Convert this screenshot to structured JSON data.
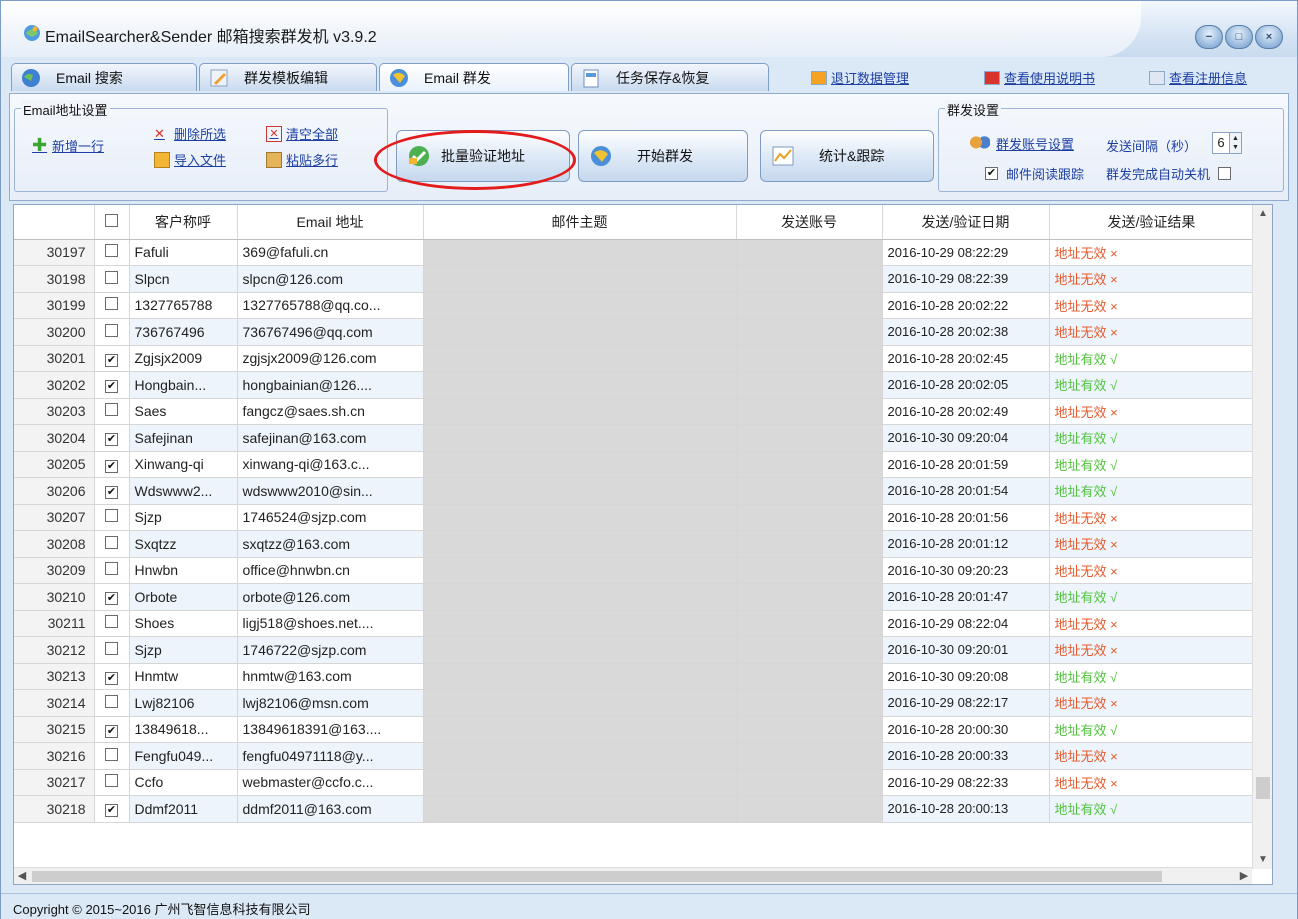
{
  "window": {
    "title": "EmailSearcher&Sender 邮箱搜索群发机 v3.9.2"
  },
  "tabs": [
    {
      "label": "Email 搜索",
      "icon": "globe-search-icon"
    },
    {
      "label": "群发模板编辑",
      "icon": "pencil-edit-icon"
    },
    {
      "label": "Email 群发",
      "icon": "globe-send-icon"
    },
    {
      "label": "任务保存&恢复",
      "icon": "document-save-icon"
    }
  ],
  "active_tab": "Email 群发",
  "top_links": {
    "unsubscribe": "退订数据管理",
    "manual": "查看使用说明书",
    "register": "查看注册信息"
  },
  "toolbar": {
    "email_group_label": "Email地址设置",
    "add_row": "新增一行",
    "delete_selected": "删除所选",
    "clear_all": "清空全部",
    "import_file": "导入文件",
    "paste_rows": "粘贴多行",
    "batch_verify": "批量验证地址",
    "start_send": "开始群发",
    "stats_track": "统计&跟踪",
    "send_group_label": "群发设置",
    "account_settings": "群发账号设置",
    "interval_label": "发送间隔（秒）",
    "interval_value": "6",
    "read_tracking": "邮件阅读跟踪",
    "read_tracking_checked": true,
    "auto_shutdown": "群发完成自动关机",
    "auto_shutdown_checked": false
  },
  "table": {
    "headers": [
      "",
      "",
      "客户称呼",
      "Email 地址",
      "邮件主题",
      "发送账号",
      "发送/验证日期",
      "发送/验证结果"
    ],
    "rows": [
      {
        "id": "30197",
        "checked": false,
        "name": "Fafuli",
        "email": "369@fafuli.cn",
        "date": "2016-10-29 08:22:29",
        "result": "地址无效 ×",
        "valid": false
      },
      {
        "id": "30198",
        "checked": false,
        "name": "Slpcn",
        "email": "slpcn@126.com",
        "date": "2016-10-29 08:22:39",
        "result": "地址无效 ×",
        "valid": false
      },
      {
        "id": "30199",
        "checked": false,
        "name": "1327765788",
        "email": "1327765788@qq.co...",
        "date": "2016-10-28 20:02:22",
        "result": "地址无效 ×",
        "valid": false
      },
      {
        "id": "30200",
        "checked": false,
        "name": "736767496",
        "email": "736767496@qq.com",
        "date": "2016-10-28 20:02:38",
        "result": "地址无效 ×",
        "valid": false
      },
      {
        "id": "30201",
        "checked": true,
        "name": "Zgjsjx2009",
        "email": "zgjsjx2009@126.com",
        "date": "2016-10-28 20:02:45",
        "result": "地址有效 √",
        "valid": true
      },
      {
        "id": "30202",
        "checked": true,
        "name": "Hongbain...",
        "email": "hongbainian@126....",
        "date": "2016-10-28 20:02:05",
        "result": "地址有效 √",
        "valid": true
      },
      {
        "id": "30203",
        "checked": false,
        "name": "Saes",
        "email": "fangcz@saes.sh.cn",
        "date": "2016-10-28 20:02:49",
        "result": "地址无效 ×",
        "valid": false
      },
      {
        "id": "30204",
        "checked": true,
        "name": "Safejinan",
        "email": "safejinan@163.com",
        "date": "2016-10-30 09:20:04",
        "result": "地址有效 √",
        "valid": true
      },
      {
        "id": "30205",
        "checked": true,
        "name": "Xinwang-qi",
        "email": "xinwang-qi@163.c...",
        "date": "2016-10-28 20:01:59",
        "result": "地址有效 √",
        "valid": true
      },
      {
        "id": "30206",
        "checked": true,
        "name": "Wdswww2...",
        "email": "wdswww2010@sin...",
        "date": "2016-10-28 20:01:54",
        "result": "地址有效 √",
        "valid": true
      },
      {
        "id": "30207",
        "checked": false,
        "name": "Sjzp",
        "email": "1746524@sjzp.com",
        "date": "2016-10-28 20:01:56",
        "result": "地址无效 ×",
        "valid": false
      },
      {
        "id": "30208",
        "checked": false,
        "name": "Sxqtzz",
        "email": "sxqtzz@163.com",
        "date": "2016-10-28 20:01:12",
        "result": "地址无效 ×",
        "valid": false
      },
      {
        "id": "30209",
        "checked": false,
        "name": "Hnwbn",
        "email": "office@hnwbn.cn",
        "date": "2016-10-30 09:20:23",
        "result": "地址无效 ×",
        "valid": false
      },
      {
        "id": "30210",
        "checked": true,
        "name": "Orbote",
        "email": "orbote@126.com",
        "date": "2016-10-28 20:01:47",
        "result": "地址有效 √",
        "valid": true
      },
      {
        "id": "30211",
        "checked": false,
        "name": "Shoes",
        "email": "ligj518@shoes.net....",
        "date": "2016-10-29 08:22:04",
        "result": "地址无效 ×",
        "valid": false
      },
      {
        "id": "30212",
        "checked": false,
        "name": "Sjzp",
        "email": "1746722@sjzp.com",
        "date": "2016-10-30 09:20:01",
        "result": "地址无效 ×",
        "valid": false
      },
      {
        "id": "30213",
        "checked": true,
        "name": "Hnmtw",
        "email": "hnmtw@163.com",
        "date": "2016-10-30 09:20:08",
        "result": "地址有效 √",
        "valid": true
      },
      {
        "id": "30214",
        "checked": false,
        "name": "Lwj82106",
        "email": "lwj82106@msn.com",
        "date": "2016-10-29 08:22:17",
        "result": "地址无效 ×",
        "valid": false
      },
      {
        "id": "30215",
        "checked": true,
        "name": "13849618...",
        "email": "13849618391@163....",
        "date": "2016-10-28 20:00:30",
        "result": "地址有效 √",
        "valid": true
      },
      {
        "id": "30216",
        "checked": false,
        "name": "Fengfu049...",
        "email": "fengfu04971118@y...",
        "date": "2016-10-28 20:00:33",
        "result": "地址无效 ×",
        "valid": false
      },
      {
        "id": "30217",
        "checked": false,
        "name": "Ccfo",
        "email": "webmaster@ccfo.c...",
        "date": "2016-10-29 08:22:33",
        "result": "地址无效 ×",
        "valid": false
      },
      {
        "id": "30218",
        "checked": true,
        "name": "Ddmf2011",
        "email": "ddmf2011@163.com",
        "date": "2016-10-28 20:00:13",
        "result": "地址有效 √",
        "valid": true
      }
    ]
  },
  "colors": {
    "invalid": "#e85a2c",
    "valid": "#52c43e",
    "highlight": "#e31b1b",
    "link": "#1d3fa3"
  },
  "statusbar": {
    "copyright": "Copyright © 2015~2016 广州飞智信息科技有限公司"
  }
}
